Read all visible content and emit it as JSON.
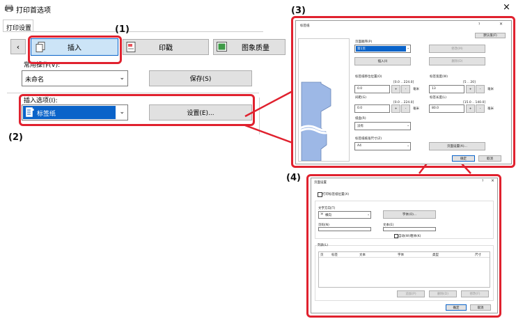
{
  "main": {
    "title": "打印首选项",
    "close": "×",
    "tab": "打印设置",
    "nav_prev": "‹",
    "tabs": [
      "插入",
      "印戳",
      "图象质量"
    ],
    "common_label": "常用操作(V):",
    "common_value": "未命名",
    "save_button": "保存(S)",
    "insert_label": "插入选项(I):",
    "insert_value": "标签纸",
    "settings_button": "设置(E)..."
  },
  "callouts": [
    "(1)",
    "(2)",
    "(3)",
    "(4)"
  ],
  "dlg3": {
    "title": "标签纸",
    "help": "?",
    "close": "×",
    "defaults_button": "默认值(F)",
    "insert_position_label": "页面顺序(P)",
    "insert_position_value": "第1页",
    "insert_button": "插入(I)",
    "delete_button": "删除(D)",
    "disabled_btn1": "修改(M)",
    "tab_offset_label": "标签纸移位位置(O)",
    "tab_offset_range": "[0.0 .. 224.0]",
    "tab_offset_value": "0.0",
    "unit": "毫米",
    "tab_count_label": "标签宽度(W)",
    "tab_count_range": "[5 .. 20]",
    "tab_count_value": "13",
    "margin_label": "间距(G)",
    "margin_range": "[0.0 .. 224.0]",
    "margin_value": "0.0",
    "tab_width_label": "标签长度(L)",
    "tab_width_range": "[15.0 .. 140.0]",
    "tab_width_value": "80.0",
    "paper_label": "纸盒(R)",
    "paper_value": "没有",
    "size_label": "标签纸纸张尺寸(Z)",
    "size_value": "A4",
    "page_setup_button": "页面设置(A)...",
    "ok": "确定",
    "cancel": "取消"
  },
  "dlg4": {
    "title": "页面设置",
    "help": "?",
    "close": "×",
    "print_tab_checkbox": "打印标签纸位置(X)",
    "text_direction_label": "文字方向(T)",
    "text_direction_value": "横向",
    "font_button": "字体(O)...",
    "page_label": "页码(N)",
    "text_label": "文本(E)",
    "bold_checkbox": "自动(W)粗体(K)",
    "list_label": "列表(L)",
    "col_no": "页",
    "col_tab": "标签",
    "col_text": "文本",
    "col_font": "字体",
    "col_type": "类型",
    "col_size": "尺寸",
    "add_button": "追加(P)",
    "delete_button": "删除(D)",
    "modify_button": "修改(F)",
    "ok": "确定",
    "cancel": "取消"
  },
  "colors": {
    "highlight": "#0a63c9",
    "callout": "#e0212e",
    "tab_shape": "#9db8e6"
  }
}
